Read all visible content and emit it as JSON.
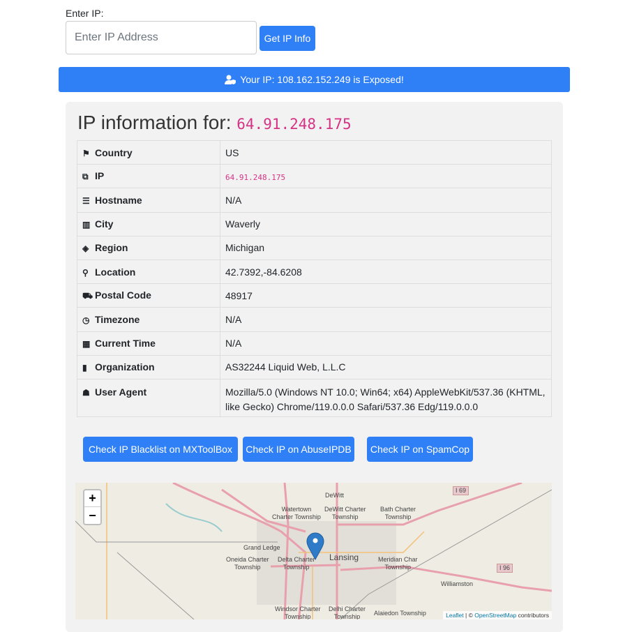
{
  "form": {
    "label": "Enter IP:",
    "placeholder": "Enter IP Address",
    "value": "",
    "button": "Get IP Info"
  },
  "banner": {
    "icon": "user-shield-icon",
    "text": "Your IP: 108.162.152.249 is Exposed!"
  },
  "info": {
    "title": "IP information for:",
    "ip": "64.91.248.175",
    "rows": [
      {
        "icon": "flag-icon",
        "glyph": "⚑",
        "label": "Country",
        "value": " US"
      },
      {
        "icon": "network-icon",
        "glyph": "⧉",
        "label": "IP",
        "value": "64.91.248.175"
      },
      {
        "icon": "server-icon",
        "glyph": "☰",
        "label": "Hostname",
        "value": "N/A"
      },
      {
        "icon": "city-icon",
        "glyph": "▥",
        "label": "City",
        "value": "Waverly"
      },
      {
        "icon": "map-location-icon",
        "glyph": "◈",
        "label": "Region",
        "value": "Michigan"
      },
      {
        "icon": "map-marker-icon",
        "glyph": "⚲",
        "label": "Location",
        "value": "42.7392,-84.6208"
      },
      {
        "icon": "truck-icon",
        "glyph": "⛟",
        "label": "Postal Code",
        "value": "48917"
      },
      {
        "icon": "clock-icon",
        "glyph": "◷",
        "label": "Timezone",
        "value": "N/A"
      },
      {
        "icon": "calendar-icon",
        "glyph": "▦",
        "label": "Current Time",
        "value": "N/A"
      },
      {
        "icon": "building-icon",
        "glyph": "▮",
        "label": "Organization",
        "value": "AS32244 Liquid Web, L.L.C"
      },
      {
        "icon": "user-secret-icon",
        "glyph": "☗",
        "label": "User Agent",
        "value": "Mozilla/5.0 (Windows NT 10.0; Win64; x64) AppleWebKit/537.36 (KHTML, like Gecko) Chrome/119.0.0.0 Safari/537.36 Edg/119.0.0.0"
      }
    ]
  },
  "actions": {
    "mxtoolbox": "Check IP Blacklist on MXToolBox",
    "abuseipdb": "Check IP on AbuseIPDB",
    "spamcop": "Check IP on SpamCop"
  },
  "map": {
    "zoom_in": "+",
    "zoom_out": "−",
    "labels": [
      "DeWitt",
      "Watertown\nCharter Township",
      "DeWitt Charter\nTownship",
      "Bath Charter\nTownship",
      "Grand Ledge",
      "Oneida Charter\nTownship",
      "Delta Charter\nTownship",
      "Lansing",
      "Meridian Char\nTownship",
      "Williamston",
      "Windsor Charter\nTownship",
      "Delhi Charter\nTownship",
      "Alaiedon Township",
      "I 69",
      "I 96"
    ],
    "attribution": {
      "leaflet": "Leaflet",
      "sep": " | © ",
      "osm": "OpenStreetMap",
      "contributors": " contributors"
    }
  }
}
